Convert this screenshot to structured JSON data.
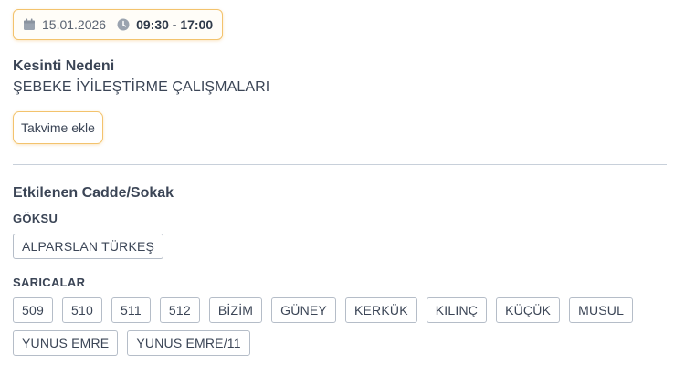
{
  "schedule": {
    "date": "15.01.2026",
    "time_range": "09:30 - 17:00",
    "date_icon": "calendar-icon",
    "time_icon": "clock-icon"
  },
  "reason": {
    "title": "Kesinti Nedeni",
    "text": "ŞEBEKE İYİLEŞTİRME ÇALIŞMALARI"
  },
  "calendar_button": {
    "label": "Takvime ekle"
  },
  "streets": {
    "title": "Etkilenen Cadde/Sokak",
    "districts": [
      {
        "name": "GÖKSU",
        "streets": [
          "ALPARSLAN TÜRKEŞ"
        ]
      },
      {
        "name": "SARICALAR",
        "streets": [
          "509",
          "510",
          "511",
          "512",
          "BİZİM",
          "GÜNEY",
          "KERKÜK",
          "KILINÇ",
          "KÜÇÜK",
          "MUSUL",
          "YUNUS EMRE",
          "YUNUS EMRE/11"
        ]
      }
    ]
  },
  "colors": {
    "accent_border": "#f3c36d",
    "text": "#3b4556",
    "divider": "#c8d0da",
    "tag_border": "#b5bdc8"
  }
}
